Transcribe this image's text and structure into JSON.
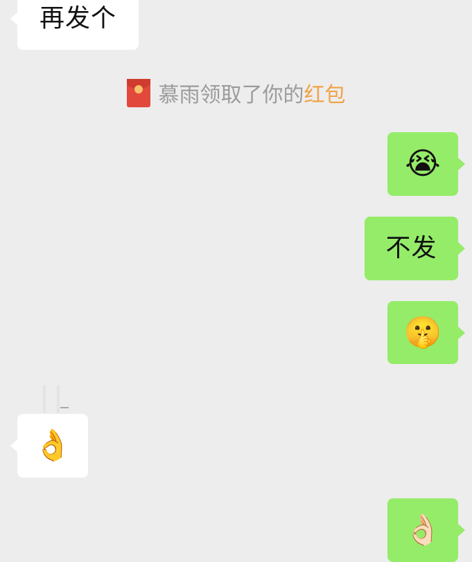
{
  "chat": {
    "messages": [
      {
        "side": "in",
        "kind": "text",
        "text": "再发个"
      },
      {
        "side": "out",
        "kind": "emoji",
        "emoji": "😭",
        "emoji_name": "loudly-crying-face"
      },
      {
        "side": "out",
        "kind": "text",
        "text": "不发"
      },
      {
        "side": "out",
        "kind": "emoji",
        "emoji": "🤫",
        "emoji_name": "shushing-face"
      },
      {
        "side": "in",
        "kind": "emoji",
        "emoji": "👌",
        "emoji_name": "ok-hand"
      },
      {
        "side": "out",
        "kind": "emoji",
        "emoji": "👌🏻",
        "emoji_name": "ok-hand-light-skin"
      }
    ],
    "notice": {
      "icon": "red-packet-icon",
      "text": "慕雨领取了你的",
      "link": "红包"
    }
  },
  "colors": {
    "background": "#ededed",
    "incoming_bubble": "#ffffff",
    "outgoing_bubble": "#95ec69",
    "notice_text": "#9b9b9b",
    "notice_link": "#f0a246",
    "red_packet": "#e2493c"
  }
}
